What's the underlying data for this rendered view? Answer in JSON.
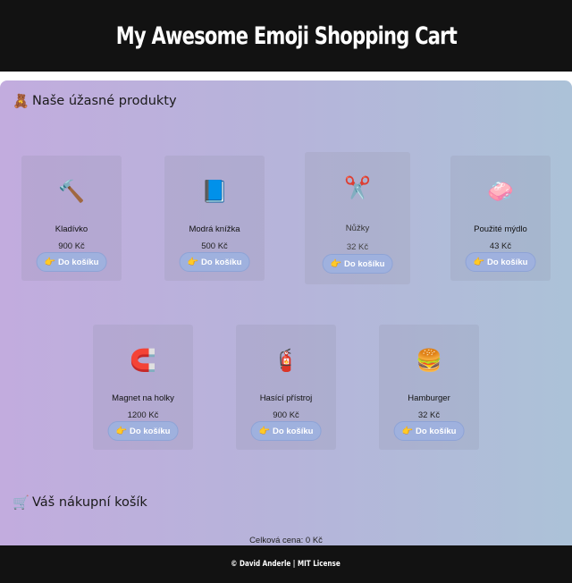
{
  "header": {
    "title": "My Awesome Emoji Shopping Cart"
  },
  "products_section": {
    "icon": "🧸",
    "title": "Naše úžasné produkty"
  },
  "products": [
    {
      "emoji": "🔨",
      "name": "Kladívko",
      "price": "900 Kč",
      "button": "Do košíku"
    },
    {
      "emoji": "📘",
      "name": "Modrá knížka",
      "price": "500 Kč",
      "button": "Do košíku"
    },
    {
      "emoji": "✂️",
      "name": "Nůžky",
      "price": "32 Kč",
      "button": "Do košíku"
    },
    {
      "emoji": "🧼",
      "name": "Použité mýdlo",
      "price": "43 Kč",
      "button": "Do košíku"
    },
    {
      "emoji": "🧲",
      "name": "Magnet na holky",
      "price": "1200 Kč",
      "button": "Do košíku"
    },
    {
      "emoji": "🧯",
      "name": "Hasící přístroj",
      "price": "900 Kč",
      "button": "Do košíku"
    },
    {
      "emoji": "🍔",
      "name": "Hamburger",
      "price": "32 Kč",
      "button": "Do košíku"
    }
  ],
  "button_icon": "👉",
  "cart_section": {
    "icon": "🛒",
    "title": "Váš nákupní košík"
  },
  "cart": {
    "total_label": "Celková cena: 0 Kč"
  },
  "footer": {
    "text": "© David Anderle | MIT License"
  },
  "colors": {
    "accent_button": "#9fb1de",
    "header_bg": "#121212"
  }
}
